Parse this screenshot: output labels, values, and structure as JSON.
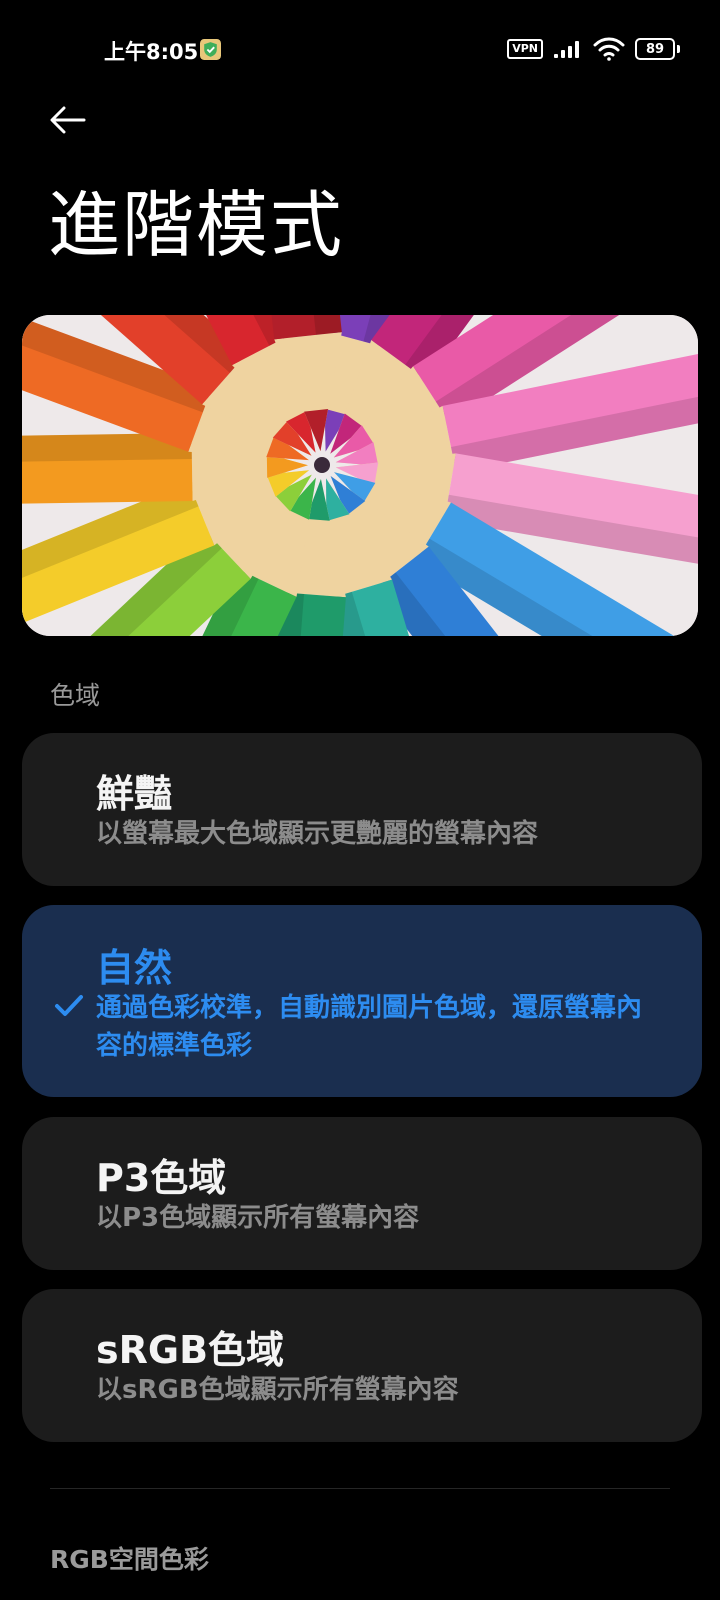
{
  "status_bar": {
    "time": "上午8:05",
    "vpn": "VPN",
    "battery": "89"
  },
  "page": {
    "title": "進階模式"
  },
  "color_gamut": {
    "section_label": "色域",
    "options": [
      {
        "title": "鮮豔",
        "description": "以螢幕最大色域顯示更艷麗的螢幕內容",
        "selected": false
      },
      {
        "title": "自然",
        "description": "通過色彩校準，自動識別圖片色域，還原螢幕內容的標準色彩",
        "selected": true
      },
      {
        "title": "P3色域",
        "description": "以P3色域顯示所有螢幕內容",
        "selected": false
      },
      {
        "title": "sRGB色域",
        "description": "以sRGB色域顯示所有螢幕內容",
        "selected": false
      }
    ]
  },
  "rgb_section": {
    "label": "RGB空間色彩"
  },
  "icons": {
    "back": "arrow-left-icon",
    "check": "check-icon",
    "signal": "signal-bars-icon",
    "wifi": "wifi-icon",
    "shield": "shield-check-icon"
  },
  "colors": {
    "background": "#000000",
    "card": "#1c1c1c",
    "selected_card": "#1a2e4f",
    "accent": "#2d8cf0",
    "secondary_text": "#8c8c8c"
  }
}
